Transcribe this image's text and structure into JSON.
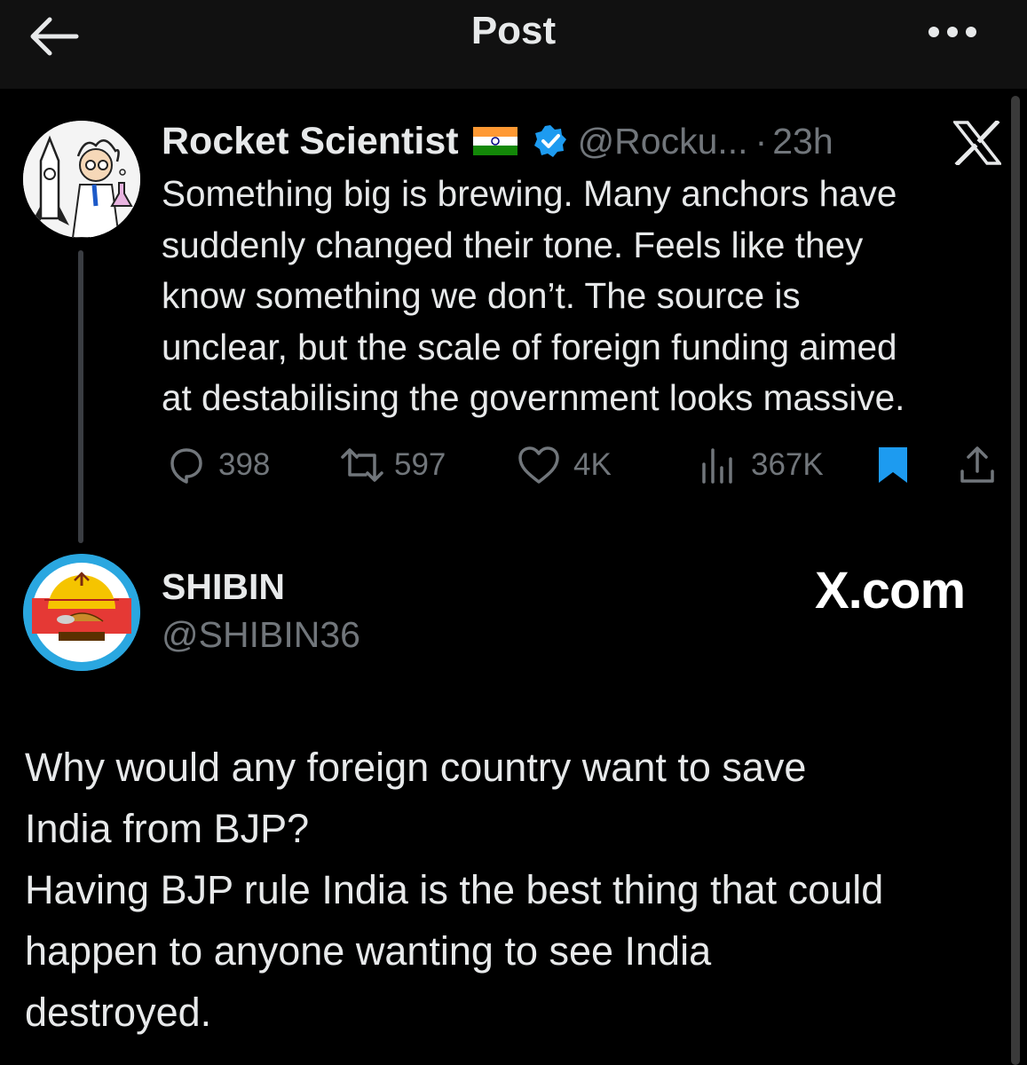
{
  "header": {
    "title": "Post",
    "back_icon": "arrow-left-icon",
    "more_icon": "more-horizontal-icon"
  },
  "tweet": {
    "author_name": "Rocket Scientist",
    "flag_icon": "india-flag-icon",
    "verified_icon": "verified-badge-icon",
    "handle": "@Rocku...",
    "separator": "·",
    "time": "23h",
    "platform_logo": "x-logo-icon",
    "lines": [
      "Something big is brewing. Many anchors have",
      "suddenly changed their tone. Feels like they",
      "know something we don’t. The source is",
      "unclear, but the scale of foreign funding aimed",
      "at destabilising the government looks massive."
    ],
    "stats": {
      "replies": "398",
      "reposts": "597",
      "likes": "4K",
      "views": "367K"
    }
  },
  "reply": {
    "author_name": "SHIBIN",
    "handle": "@SHIBIN36",
    "watermark": "X.com",
    "lines": [
      "Why would any foreign country want to save",
      "India from BJP?",
      "Having BJP rule India is the best thing that could",
      "happen to anyone wanting to see India",
      "destroyed."
    ]
  },
  "colors": {
    "background": "#000000",
    "header_bg": "#111111",
    "text": "#e7e9ea",
    "muted": "#71767b",
    "accent": "#1d9bf0"
  }
}
